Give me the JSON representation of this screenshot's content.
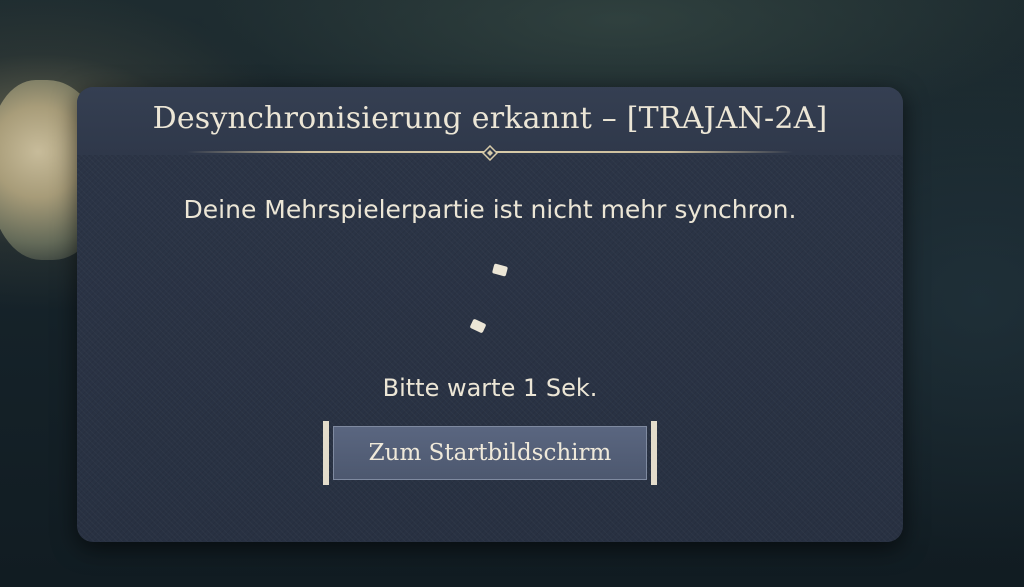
{
  "dialog": {
    "title": "Desynchronisierung erkannt – [TRAJAN-2A]",
    "message": "Deine Mehrspielerpartie ist nicht mehr synchron.",
    "wait_text": "Bitte warte 1 Sek.",
    "button_label": "Zum Startbildschirm"
  },
  "icons": {
    "divider": "diamond-ornament-icon",
    "loading": "loading-spinner-icon"
  },
  "colors": {
    "panel": "#293244",
    "text": "#ece6d6",
    "button": "#5a6680",
    "bracket": "#e3dccb"
  }
}
